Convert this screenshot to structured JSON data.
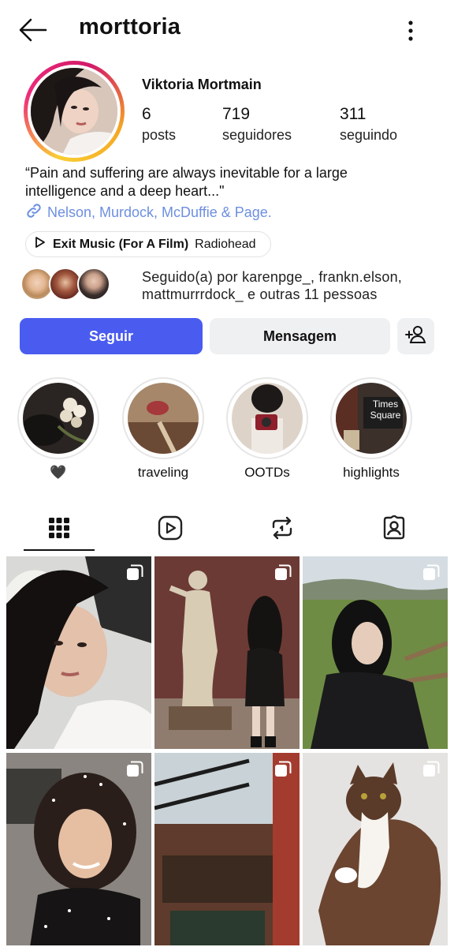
{
  "header": {
    "username": "morttoria"
  },
  "profile": {
    "display_name": "Viktoria Mortmain",
    "stats": [
      {
        "value": "6",
        "label": "posts"
      },
      {
        "value": "719",
        "label": "seguidores"
      },
      {
        "value": "311",
        "label": "seguindo"
      }
    ],
    "bio_line1": "“Pain and suffering are always inevitable for a large",
    "bio_line2": "intelligence and a deep heart...\"",
    "link": "Nelson, Murdock, McDuffie & Page.",
    "music": {
      "song": "Exit Music (For A Film)",
      "artist": "Radiohead"
    },
    "followed_by_line1": "Seguido(a) por karenpge_, frankn.elson,",
    "followed_by_line2": "mattmurrrdock_ e outras 11 pessoas"
  },
  "actions": {
    "follow": "Seguir",
    "message": "Mensagem"
  },
  "highlights": [
    {
      "label": "🖤"
    },
    {
      "label": "traveling"
    },
    {
      "label": "OOTDs"
    },
    {
      "label": "highlights",
      "sign_text": "Times Square"
    }
  ],
  "tabs": [
    "grid-icon",
    "reels-icon",
    "reposts-icon",
    "tagged-icon"
  ],
  "colors": {
    "accent": "#4a5cf0",
    "link": "#6d8fe0",
    "button_bg": "#eff0f2"
  }
}
